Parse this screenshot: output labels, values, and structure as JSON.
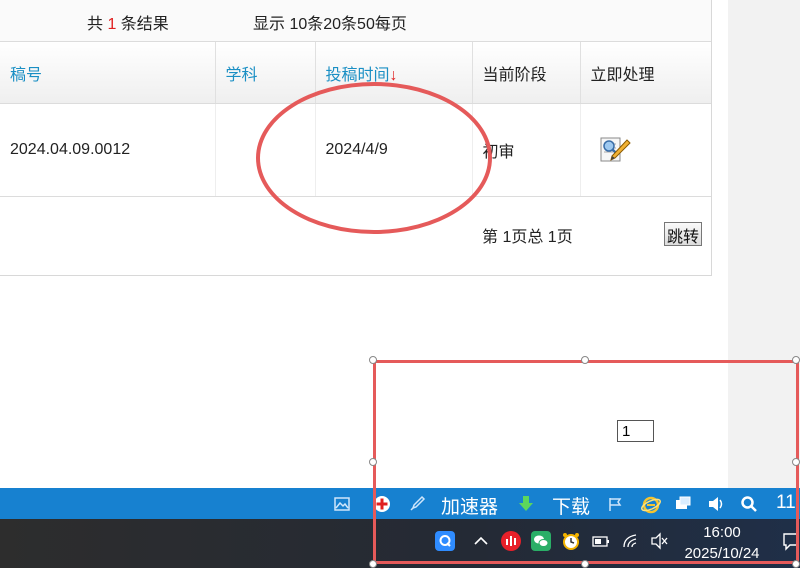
{
  "summary": {
    "total_prefix": "共 ",
    "total_count": "1",
    "total_suffix": " 条结果",
    "per_page": "显示 10条20条50每页"
  },
  "table": {
    "headers": {
      "manuscript_no": "稿号",
      "subject": "学科",
      "submit_time": "投稿时间",
      "sort_arrow": "↓",
      "stage": "当前阶段",
      "action": "立即处理"
    },
    "rows": [
      {
        "manuscript_no": "2024.04.09.0012",
        "subject": "",
        "submit_time": "2024/4/9",
        "stage": "初审",
        "action_icon": "edit-icon"
      }
    ]
  },
  "pager": {
    "info": "第 1页总 1页",
    "page_value": "1",
    "jump_label": "跳转"
  },
  "taskbar_top": {
    "accelerator": "加速器",
    "download": "下载",
    "partial_number": "11"
  },
  "taskbar_bottom": {
    "time": "16:00",
    "date": "2025/10/24"
  },
  "colors": {
    "link_blue": "#1a8fc4",
    "highlight_red": "#e02020",
    "annotation_red": "#e55a5a",
    "taskbar_blue": "#1781d0",
    "taskbar_dark": "#2d2d2d"
  }
}
